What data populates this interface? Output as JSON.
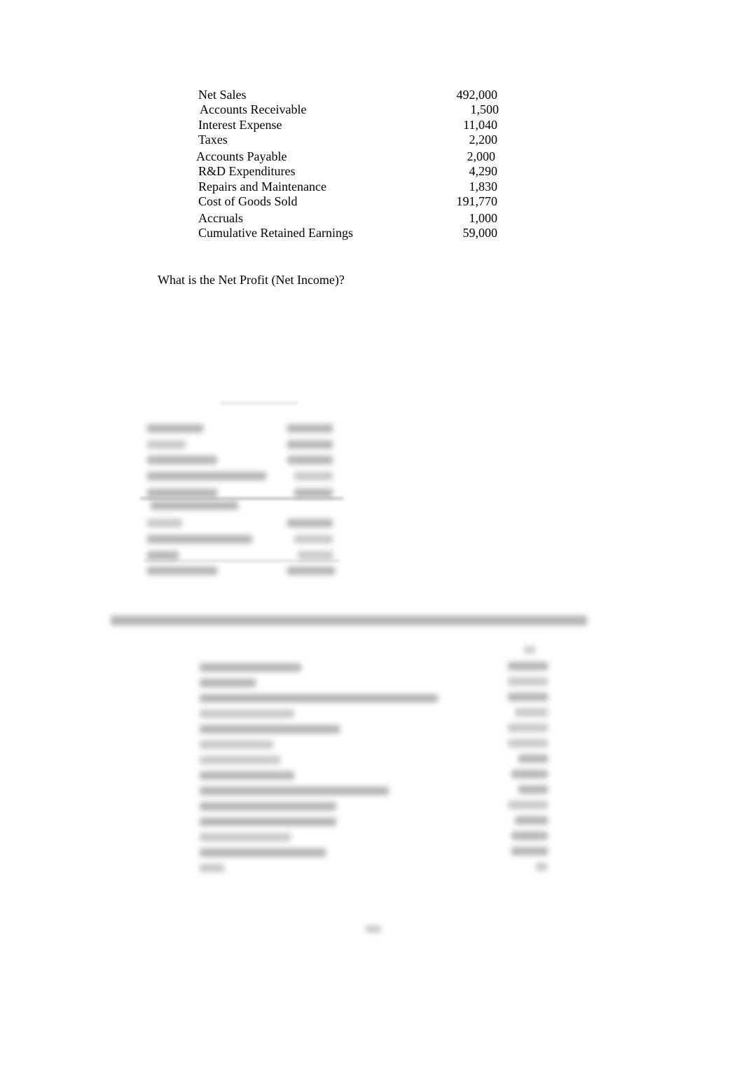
{
  "items": [
    {
      "label": "Net Sales",
      "value": "492,000"
    },
    {
      "label": "Accounts Receivable",
      "value": "1,500"
    },
    {
      "label": "Interest Expense",
      "value": "11,040"
    },
    {
      "label": "Taxes",
      "value": "2,200"
    },
    {
      "label": "Accounts Payable",
      "value": "2,000"
    },
    {
      "label": "R&D Expenditures",
      "value": "4,290"
    },
    {
      "label": "Repairs and Maintenance",
      "value": "1,830"
    },
    {
      "label": "Cost of Goods Sold",
      "value": "191,770"
    },
    {
      "label": "Accruals",
      "value": "1,000"
    },
    {
      "label": "Cumulative Retained Earnings",
      "value": "59,000"
    }
  ],
  "question": "What is the Net Profit (Net Income)?",
  "obscured_sections": [
    "answer-table",
    "next-question",
    "balance-list",
    "page-number"
  ]
}
